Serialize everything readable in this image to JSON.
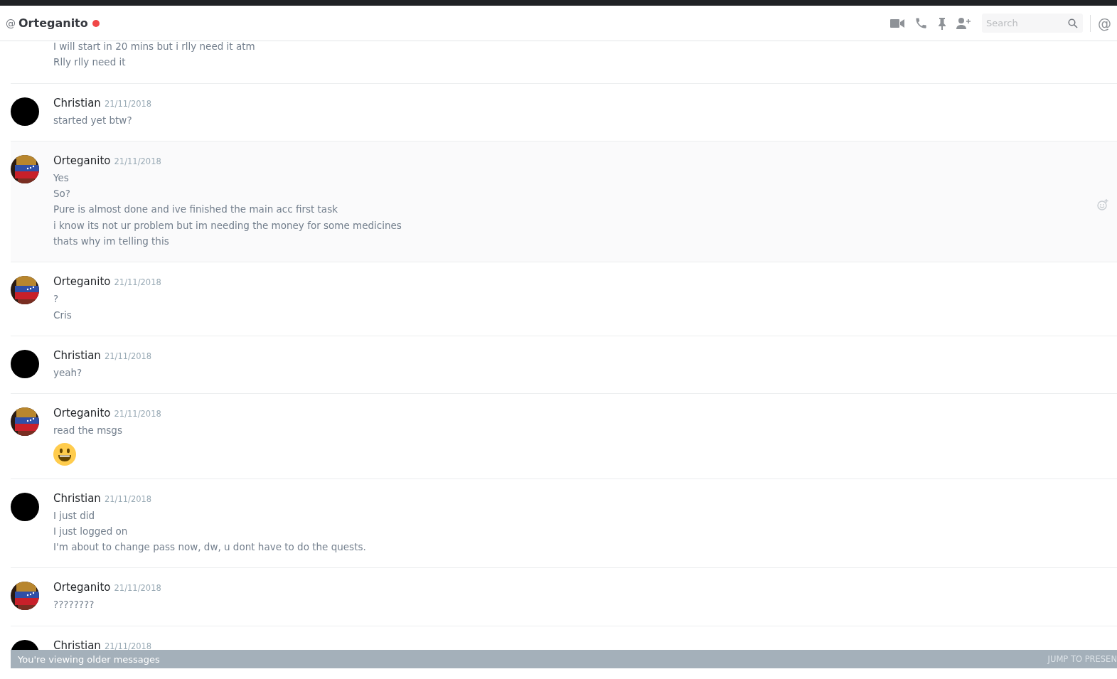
{
  "header": {
    "at_sign": "@",
    "title": "Orteganito",
    "do_not_disturb": true,
    "search": {
      "placeholder": "Search"
    },
    "mentions": "@"
  },
  "messages": [
    {
      "kind": "continued",
      "hovered": false,
      "lines": [
        "I will start in 20 mins but i rlly need it atm",
        "Rlly rlly need it"
      ]
    },
    {
      "kind": "group",
      "author": "Christian",
      "has_picture": false,
      "time": "21/11/2018",
      "hovered": false,
      "lines": [
        "started yet btw?"
      ]
    },
    {
      "kind": "group",
      "author": "Orteganito",
      "has_picture": true,
      "time": "21/11/2018",
      "hovered": true,
      "lines": [
        "Yes",
        "So?",
        "Pure is almost done and ive finished the main acc first task",
        "i know its not ur problem but im needing the money for some medicines",
        "thats why im telling this"
      ]
    },
    {
      "kind": "group",
      "author": "Orteganito",
      "has_picture": true,
      "time": "21/11/2018",
      "hovered": false,
      "lines": [
        "?",
        "Cris"
      ]
    },
    {
      "kind": "group",
      "author": "Christian",
      "has_picture": false,
      "time": "21/11/2018",
      "hovered": false,
      "lines": [
        "yeah?"
      ]
    },
    {
      "kind": "group",
      "author": "Orteganito",
      "has_picture": true,
      "time": "21/11/2018",
      "hovered": false,
      "lines": [
        "read the msgs"
      ],
      "emoji": true
    },
    {
      "kind": "group",
      "author": "Christian",
      "has_picture": false,
      "time": "21/11/2018",
      "hovered": false,
      "lines": [
        "I just did",
        "I just logged on",
        "I'm about to change pass now, dw, u dont have to do the quests."
      ]
    },
    {
      "kind": "group",
      "author": "Orteganito",
      "has_picture": true,
      "time": "21/11/2018",
      "hovered": false,
      "lines": [
        "????????"
      ]
    },
    {
      "kind": "group",
      "author": "Christian",
      "has_picture": false,
      "time": "21/11/2018",
      "hovered": false
    }
  ],
  "older_bar": {
    "text": "You're viewing older messages",
    "action": "JUMP TO PRESEN"
  }
}
